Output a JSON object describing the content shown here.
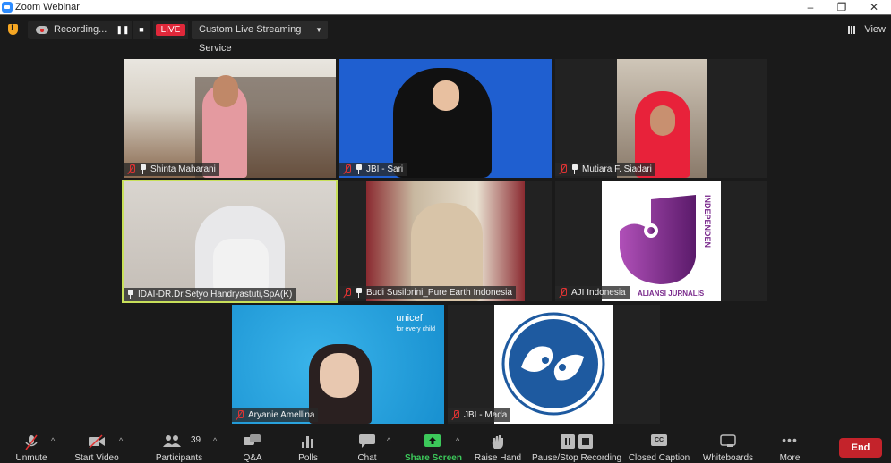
{
  "window": {
    "title": "Zoom Webinar",
    "minimize": "–",
    "restore": "❐",
    "close": "✕"
  },
  "topbar": {
    "security_icon": "shield-icon",
    "recording_status": "Recording...",
    "pause_label": "❚❚",
    "stop_label": "■",
    "live_badge": "LIVE",
    "stream_service": "Custom Live Streaming Service",
    "stream_caret": "▼",
    "view_label": "View"
  },
  "participants": [
    {
      "name": "Shinta Maharani",
      "muted": true,
      "pinned": true,
      "bg": "#b9a58c"
    },
    {
      "name": "JBI - Sari",
      "muted": true,
      "pinned": true,
      "bg": "#1f5fd0"
    },
    {
      "name": "Mutiara F. Siadari",
      "muted": true,
      "pinned": true,
      "bg": "#8a7a6a"
    },
    {
      "name": "IDAI-DR.Dr.Setyo Handryastuti,SpA(K)",
      "muted": false,
      "pinned": true,
      "active_speaker": true,
      "bg": "#cfcac4"
    },
    {
      "name": "Budi Susilorini_Pure Earth Indonesia",
      "muted": true,
      "pinned": true,
      "bg": "#a08770"
    },
    {
      "name": "AJI Indonesia",
      "muted": true,
      "pinned": false,
      "bg": "#ffffff",
      "logo_text": "ALIANSI JURNALIS INDEPENDEN",
      "logo_color": "#7a2a8c"
    },
    {
      "name": "Aryanie Amellina",
      "muted": true,
      "pinned": false,
      "bg": "#1fa0e0",
      "overlay_title": "unicef",
      "overlay_sub": "for every child"
    },
    {
      "name": "JBI - Mada",
      "muted": true,
      "pinned": false,
      "bg": "#ffffff",
      "logo_color": "#1e5aa0"
    }
  ],
  "toolbar": {
    "unmute": "Unmute",
    "start_video": "Start Video",
    "participants": "Participants",
    "participants_count": "39",
    "qa": "Q&A",
    "polls": "Polls",
    "chat": "Chat",
    "share_screen": "Share Screen",
    "raise_hand": "Raise Hand",
    "pause_stop_recording": "Pause/Stop Recording",
    "closed_caption": "Closed Caption",
    "cc_badge": "CC",
    "whiteboards": "Whiteboards",
    "more": "More",
    "end": "End",
    "caret": "^",
    "share_color": "#3cc85a",
    "end_color": "#c4232b"
  }
}
